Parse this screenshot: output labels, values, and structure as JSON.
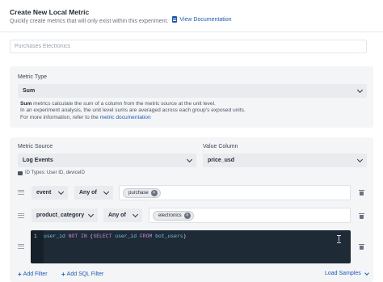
{
  "header": {
    "title": "Create New Local Metric",
    "subtitle": "Quickly create metrics that will only exist within this experiment.",
    "doc_link": "View Documentation"
  },
  "metric_name": {
    "placeholder": "Purchases Electronics"
  },
  "metric_type": {
    "label": "Metric Type",
    "value": "Sum",
    "desc_strong": "Sum",
    "desc_line1": " metrics calculate the sum of a column from the metric source at the unit level.",
    "desc_line2": "In an experiment analysis, the unit level sums are averaged across each group's exposed units.",
    "desc_line3": "For more information, refer to the ",
    "desc_link": "metric documentation"
  },
  "source": {
    "label": "Metric Source",
    "value": "Log Events",
    "id_types": "ID Types: User ID, deviceID"
  },
  "value_column": {
    "label": "Value Column",
    "value": "price_usd"
  },
  "filters": [
    {
      "field": "event",
      "operator": "Any of",
      "chip": "purchase"
    },
    {
      "field": "product_category",
      "operator": "Any of",
      "chip": "electronics"
    }
  ],
  "sql_filter": {
    "line_number": "1",
    "tokens": [
      {
        "text": "user_id ",
        "type": "fn"
      },
      {
        "text": "NOT IN ",
        "type": "kw"
      },
      {
        "text": "(",
        "type": "plain"
      },
      {
        "text": "SELECT ",
        "type": "kw"
      },
      {
        "text": "user_id ",
        "type": "fn"
      },
      {
        "text": "FROM ",
        "type": "kw"
      },
      {
        "text": "bot_users",
        "type": "fn"
      },
      {
        "text": ")",
        "type": "plain"
      }
    ]
  },
  "footer": {
    "add_filter": "Add Filter",
    "add_sql_filter": "Add SQL Filter",
    "load_samples": "Load Samples"
  },
  "colors": {
    "accent": "#1b5bb8",
    "panel": "#f4f5f7",
    "editor": "#1e2a35"
  }
}
